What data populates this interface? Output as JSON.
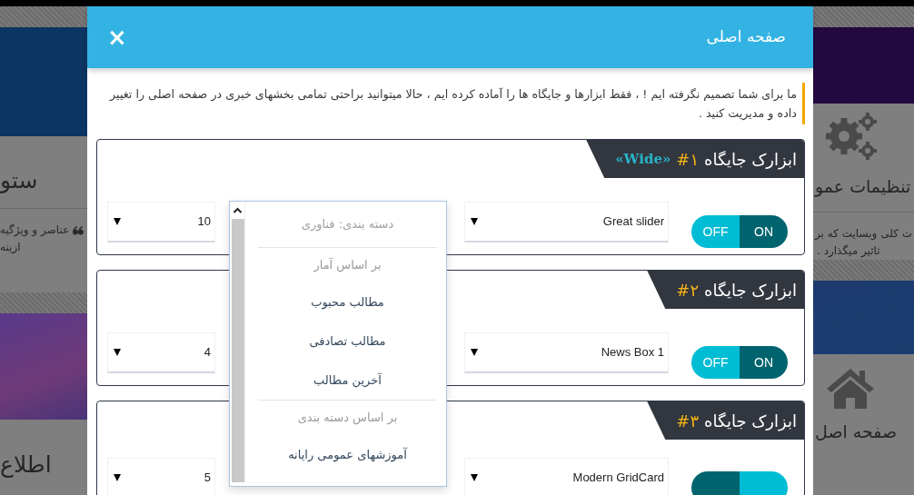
{
  "backdrop": {
    "left": [
      {
        "heading": "ستو",
        "lines": [
          "عناصر و ویژگیه",
          "ازینه"
        ]
      },
      {
        "heading": "اطلاع"
      }
    ],
    "right": [
      {
        "heading": "تنظیمات عمو",
        "lines": [
          "ت کلی وبسایت که بر",
          "تاثیر میگذارد ."
        ]
      },
      {
        "heading": "صفحه اصل"
      }
    ]
  },
  "modal": {
    "title": "صفحه اصلی",
    "close": "×",
    "intro": "ما برای شما تصمیم نگرفته ایم ! ، فقط ابزارها و جایگاه ها را آماده کرده ایم ، حالا میتوانید براحتی تمامی بخشهای خبری در صفحه اصلی را تغییر داده و مدیریت کنید .",
    "panels": [
      {
        "title": "ابزارک جایگاه",
        "number": "#۱",
        "tag": "«Wide»",
        "toggle": {
          "on": true,
          "off_label": "OFF",
          "on_label": "ON"
        },
        "widget": "Great slider",
        "count": "10"
      },
      {
        "title": "ابزارک جایگاه",
        "number": "#۲",
        "toggle": {
          "on": true,
          "off_label": "OFF",
          "on_label": "ON"
        },
        "widget": "News Box 1",
        "count": "4"
      },
      {
        "title": "ابزارک جایگاه",
        "number": "#۳",
        "toggle": {
          "on": false
        },
        "widget": "Modern GridCard",
        "count": "5"
      }
    ],
    "dropdown": {
      "items": [
        {
          "kind": "current",
          "text": "دسته بندی: فناوری"
        },
        {
          "kind": "divider"
        },
        {
          "kind": "group",
          "text": "بر اساس آمار"
        },
        {
          "kind": "option",
          "text": "مطالب محبوب"
        },
        {
          "kind": "option",
          "text": "مطالب تصادفی"
        },
        {
          "kind": "option",
          "text": "آخرین مطالب"
        },
        {
          "kind": "divider"
        },
        {
          "kind": "group",
          "text": "بر اساس دسته بندی"
        },
        {
          "kind": "option",
          "text": "آموزشهای عمومی رایانه"
        }
      ]
    }
  }
}
